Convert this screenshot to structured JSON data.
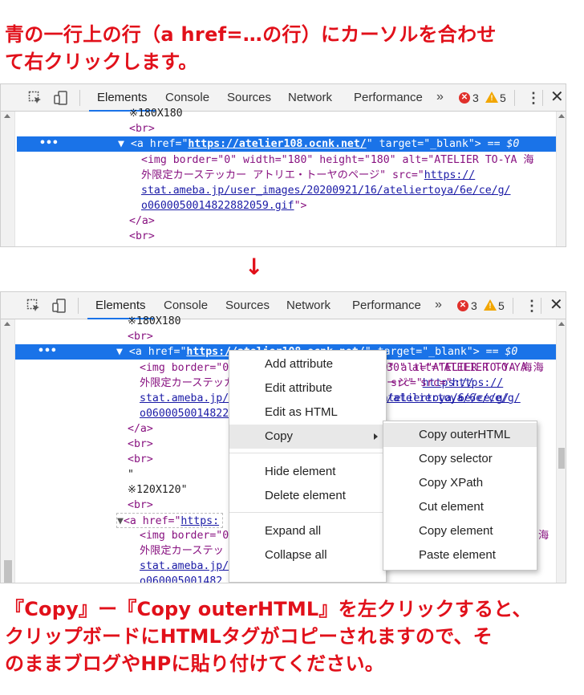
{
  "captions": {
    "top_line1": "青の一行上の行（a href=…の行）にカーソルを合わせ",
    "top_line2": "て右クリックします。",
    "arrow": "↓",
    "bottom_line1": "『Copy』ー『Copy outerHTML』を左クリックすると、",
    "bottom_line2": "クリップボードにHTMLタグがコピーされますので、そ",
    "bottom_line3": "のままブログやHPに貼り付けてください。"
  },
  "devtools": {
    "tabs": [
      "Elements",
      "Console",
      "Sources",
      "Network",
      "Performance"
    ],
    "active_tab": "Elements",
    "more_tabs": "»",
    "error_count": "3",
    "warning_count": "5",
    "kebab": "⋮",
    "close": "✕",
    "selected_suffix": "== $0",
    "dom_top": {
      "line0": "※180X180",
      "br": "<br>",
      "a_open": "<a",
      "href_attr": "href=",
      "href_val": "https://atelier108.ocnk.net/",
      "target_attr": "target=",
      "target_val": "\"_blank\"",
      "img_line1_prefix": "<img border=\"0\" width=\"180\" height=\"180\" alt=\"ATELIER TO-YA 海",
      "img_line2_text": "外限定カーステッカー アトリエ・トーヤのページ\" src=\"",
      "img_url_part1": "https://",
      "img_url_part2": "stat.ameba.jp/user_images/20200921/16/ateliertoya/6e/ce/g/",
      "img_url_part3": "o0600050014822882059.gif",
      "img_close": "\">",
      "a_close": "</a>"
    },
    "dom_bottom": {
      "quote": "\"",
      "text_120": "※120X120\"",
      "a_open_plain": "<a href=\"",
      "href_partial": "https:",
      "img_border_partial": "<img border=\"0",
      "kaigai_partial": "外限定カーステッ",
      "stat_partial": "stat.ameba.jp/",
      "o06_partial": "o060005001482",
      "o06_partial2": "o060005001482",
      "page_tail": "ージ\" src=\"",
      "https_tail": "https://",
      "path_tail": "/ateliertoya/6e/ce/g/",
      "r30": "30\"",
      "alt_tail": "alt=\"ATELIER TO-YA 海",
      "umi": "海",
      "span_tail": "\">",
      "dash_tail": "\"_blank\""
    }
  },
  "context_menu": {
    "items": [
      "Add attribute",
      "Edit attribute",
      "Edit as HTML",
      "Copy",
      "Hide element",
      "Delete element",
      "Expand all",
      "Collapse all"
    ],
    "hovered": "Copy"
  },
  "copy_submenu": {
    "items": [
      "Copy outerHTML",
      "Copy selector",
      "Copy XPath",
      "Cut element",
      "Copy element",
      "Paste element"
    ],
    "hovered": "Copy outerHTML"
  },
  "colors": {
    "caption_red": "#e1101a",
    "selection_blue": "#1a73e8",
    "error_red": "#e0302b",
    "warning_yellow": "#f2a600"
  }
}
